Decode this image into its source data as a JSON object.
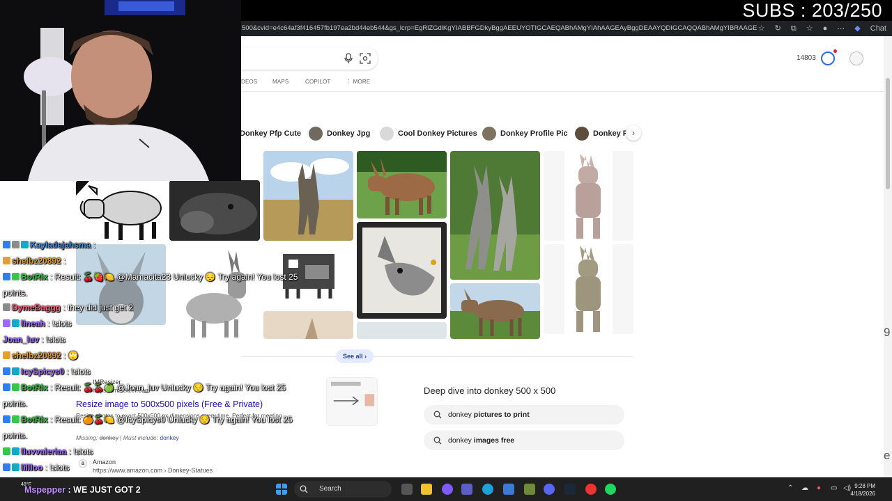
{
  "overlay": {
    "subs": "SUBS : 203/250"
  },
  "browser": {
    "url": "500&cvid=e4c64af3f416457fb197ea2bd44eb544&gs_lcrp=EgRlZGdlKgYIABBFGDkyBggAEEUYOTIGCAEQABhAMgYIAhAAGEAyBggDEAAYQDIGCAQQABhAMgYIBRAAGEAyBggG",
    "chat_label": "Chat",
    "icons": [
      "star-icon",
      "refresh-icon",
      "extensions-icon",
      "favorites-icon",
      "profile-icon",
      "more-icon",
      "copilot-icon"
    ]
  },
  "search": {
    "points": "14803",
    "tabs": [
      "DEOS",
      "MAPS",
      "COPILOT",
      "⋮ MORE"
    ],
    "chips": [
      "Donkey Pfp Cute",
      "Donkey Jpg",
      "Cool Donkey Pictures",
      "Donkey Profile Pic",
      "Donkey P"
    ],
    "see_all": "See all",
    "result": {
      "site": "IMResizer",
      "url": "https://imresizer.com",
      "title": "Resize image to 500x500 pixels (Free & Private)",
      "snippet": "Resize photos to exact 500x500 px dimensions every time. Perfect for meeting",
      "missing_label": "Missing:",
      "missing_term": "donkey",
      "must_include_label": "| Must include:",
      "must_include_term": "donkey"
    },
    "amazon": {
      "name": "Amazon",
      "url": "https://www.amazon.com › Donkey-Statues"
    },
    "deep_dive": {
      "title": "Deep dive into donkey 500 x 500",
      "items": [
        {
          "plain": "donkey ",
          "bold": "pictures to print"
        },
        {
          "plain": "donkey ",
          "bold": "images free"
        }
      ]
    },
    "edge_chars": [
      "9",
      "e"
    ]
  },
  "chat": [
    {
      "name": "Kayladejahsma",
      "sep": " : ",
      "text": "",
      "color": "#3f8fe8",
      "badges": [
        "#2e7ff0",
        "#8c8c8c",
        "#17a8c8"
      ]
    },
    {
      "name": "shelbz20892",
      "sep": " : ",
      "text": "",
      "color": "#e09a2a",
      "badges": [
        "#e0a132"
      ]
    },
    {
      "name": "BotRix",
      "sep": " : ",
      "text": "Result: 🍒🍓🍋  @Mamacita23 Unlucky 😔 Try again! You lost 25",
      "color": "#39c44a",
      "badges": [
        "#2e7ff0",
        "#39c44a"
      ]
    },
    {
      "name": "",
      "sep": "",
      "text": "points.",
      "color": "#fff",
      "badges": []
    },
    {
      "name": "DymeBaggg",
      "sep": " : ",
      "text": "they did just get 2",
      "color": "#ff5c7a",
      "badges": [
        "#8c8c8c"
      ]
    },
    {
      "name": "lineah",
      "sep": " : ",
      "text": "!slots",
      "color": "#9b6bff",
      "badges": [
        "#9b6bff",
        "#17a8c8"
      ]
    },
    {
      "name": "Joan_luv",
      "sep": " : ",
      "text": "!slots",
      "color": "#9b6bff",
      "badges": []
    },
    {
      "name": "shelbz20892",
      "sep": " : ",
      "text": "🙄",
      "color": "#e09a2a",
      "badges": [
        "#e0a132"
      ]
    },
    {
      "name": "IcySpicys0",
      "sep": " : ",
      "text": "!slots",
      "color": "#9b6bff",
      "badges": [
        "#2e7ff0",
        "#17a8c8"
      ]
    },
    {
      "name": "BotRix",
      "sep": " : ",
      "text": "Result: 🍒🍒🍏  @Joan_luv Unlucky 😔 Try again! You lost 25",
      "color": "#39c44a",
      "badges": [
        "#2e7ff0",
        "#39c44a"
      ]
    },
    {
      "name": "",
      "sep": "",
      "text": "points.",
      "color": "#fff",
      "badges": []
    },
    {
      "name": "BotRix",
      "sep": " : ",
      "text": "Result: 🍊🍒🍋  @IcySpicys0 Unlucky 😔 Try again! You lost 25",
      "color": "#39c44a",
      "badges": [
        "#2e7ff0",
        "#39c44a"
      ]
    },
    {
      "name": "",
      "sep": "",
      "text": "points.",
      "color": "#fff",
      "badges": []
    },
    {
      "name": "lluvvaleriaa",
      "sep": " : ",
      "text": "!slots",
      "color": "#9b6bff",
      "badges": [
        "#39c44a",
        "#17a8c8"
      ]
    },
    {
      "name": "lillloo",
      "sep": " : ",
      "text": "!slots",
      "color": "#9b6bff",
      "badges": [
        "#2e7ff0",
        "#17a8c8"
      ]
    }
  ],
  "chat_last": {
    "name": "Mspepper",
    "text": " : WE JUST GOT 2"
  },
  "taskbar": {
    "weather": "48°F",
    "search_label": "Search",
    "time": "9:28 PM",
    "date": "4/18/2026"
  },
  "colors": {
    "bing_blue": "#1a0dab",
    "chip_bg": "#f3f3f3",
    "taskbar": "#202020"
  }
}
